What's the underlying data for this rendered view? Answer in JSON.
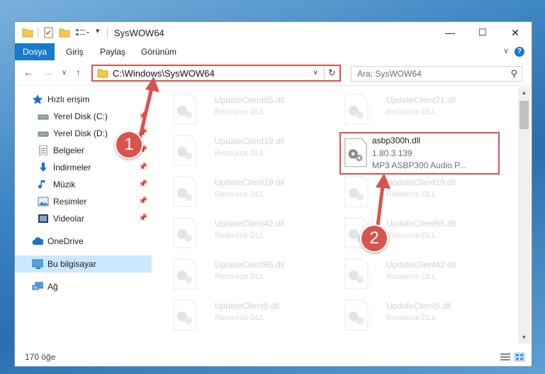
{
  "window": {
    "title": "SysWOW64",
    "controls": {
      "minimize": "—",
      "maximize": "☐",
      "close": "✕"
    }
  },
  "ribbon": {
    "tabs": [
      {
        "label": "Dosya",
        "active": true
      },
      {
        "label": "Giriş"
      },
      {
        "label": "Paylaş"
      },
      {
        "label": "Görünüm"
      }
    ],
    "help": "?"
  },
  "nav": {
    "back": "←",
    "forward": "→",
    "recent": "∨",
    "up": "↑",
    "address": "C:\\Windows\\SysWOW64",
    "refresh": "↻",
    "search_placeholder": "Ara: SysWOW64"
  },
  "sidebar": {
    "items": [
      {
        "label": "Hızlı erişim",
        "icon": "star-icon"
      },
      {
        "label": "Yerel Disk (C:)",
        "icon": "drive-icon",
        "pinned": true
      },
      {
        "label": "Yerel Disk (D:)",
        "icon": "drive-icon",
        "pinned": true
      },
      {
        "label": "Belgeler",
        "icon": "documents-icon",
        "pinned": true
      },
      {
        "label": "İndirmeler",
        "icon": "download-icon",
        "pinned": true
      },
      {
        "label": "Müzik",
        "icon": "music-icon",
        "pinned": true
      },
      {
        "label": "Resimler",
        "icon": "pictures-icon",
        "pinned": true
      },
      {
        "label": "Videolar",
        "icon": "videos-icon",
        "pinned": true
      },
      {
        "label": "OneDrive",
        "icon": "cloud-icon"
      },
      {
        "label": "Bu bilgisayar",
        "icon": "computer-icon",
        "selected": true
      },
      {
        "label": "Ağ",
        "icon": "network-icon"
      }
    ]
  },
  "files": [
    {
      "name": "UpdateClient65.dll",
      "desc": "Resource DLL"
    },
    {
      "name": "UpdateClient21.dll",
      "desc": "Resource DLL"
    },
    {
      "name": "UpdateClient19.dll",
      "desc": "Resource DLL"
    },
    {
      "name": "asbp300h.dll",
      "version": "1.80.3.139",
      "desc": "MP3 ASBP300 Audio P..."
    },
    {
      "name": "UpdateClient19.dll",
      "desc": "Resource DLL"
    },
    {
      "name": "UpdateClient19.dll",
      "desc": "Resource DLL"
    },
    {
      "name": "UpdateClient42.dll",
      "desc": "Resource DLL"
    },
    {
      "name": "UpdateClient65.dll",
      "desc": "Resource DLL"
    },
    {
      "name": "UpdateClient65.dll",
      "desc": "Resource DLL"
    },
    {
      "name": "UpdateClient42.dll",
      "desc": "Resource DLL"
    },
    {
      "name": "UpdateClient5.dll",
      "desc": "Resource DLL"
    },
    {
      "name": "UpdateClient5.dll",
      "desc": "Resource DLL"
    }
  ],
  "status": {
    "count": "170 öğe"
  },
  "callouts": {
    "one": "1",
    "two": "2"
  },
  "colors": {
    "accent": "#1979ca",
    "highlight": "#d9534f",
    "selected": "#cce8ff"
  }
}
